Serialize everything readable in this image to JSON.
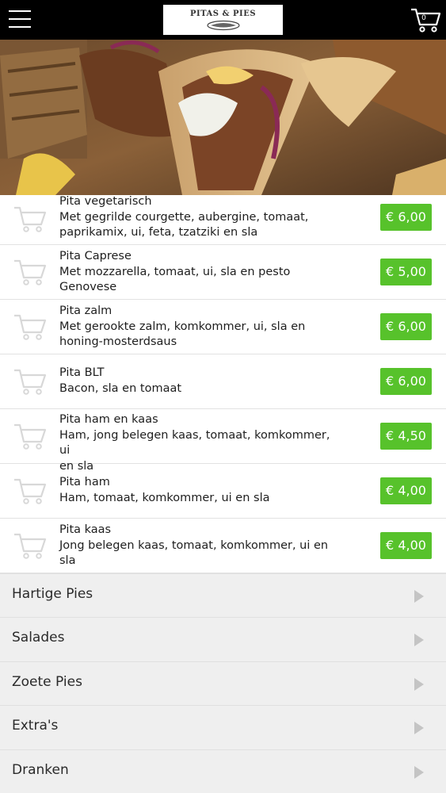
{
  "header": {
    "menu_icon": "hamburger-menu-icon",
    "logo_text": "PITAS & PIES",
    "cart_icon": "shopping-cart-icon",
    "cart_count": "0",
    "colors": {
      "bar": "#000000"
    }
  },
  "hero": {
    "image": "pita-gyros-wrap-photo"
  },
  "menu_items": [
    {
      "name": "Pita vegetarisch",
      "desc_line1": "Met gegrilde courgette, aubergine, tomaat,",
      "desc_line2": "paprikamix, ui, feta, tzatziki en sla",
      "price": "€ 6,00"
    },
    {
      "name": "Pita Caprese",
      "desc_line1": "Met mozzarella, tomaat, ui, sla en pesto",
      "desc_line2": "Genovese",
      "price": "€ 5,00"
    },
    {
      "name": "Pita zalm",
      "desc_line1": "Met gerookte zalm, komkommer, ui, sla en",
      "desc_line2": "honing-mosterdsaus",
      "price": "€ 6,00"
    },
    {
      "name": "Pita BLT",
      "desc_line1": "Bacon, sla en tomaat",
      "desc_line2": "",
      "price": "€ 6,00"
    },
    {
      "name": "Pita ham en kaas",
      "desc_line1": "Ham, jong belegen kaas, tomaat, komkommer, ui",
      "desc_line2": "en sla",
      "price": "€ 4,50"
    },
    {
      "name": "Pita ham",
      "desc_line1": "Ham, tomaat, komkommer, ui en sla",
      "desc_line2": "",
      "price": "€ 4,00"
    },
    {
      "name": "Pita kaas",
      "desc_line1": "Jong belegen kaas, tomaat, komkommer, ui en",
      "desc_line2": "sla",
      "price": "€ 4,00"
    }
  ],
  "categories": [
    {
      "label": "Hartige Pies"
    },
    {
      "label": "Salades"
    },
    {
      "label": "Zoete Pies"
    },
    {
      "label": "Extra's"
    },
    {
      "label": "Dranken"
    }
  ],
  "colors": {
    "price_button": "#57c22b",
    "category_bg": "#efefef",
    "arrow": "#c4c4c4"
  }
}
